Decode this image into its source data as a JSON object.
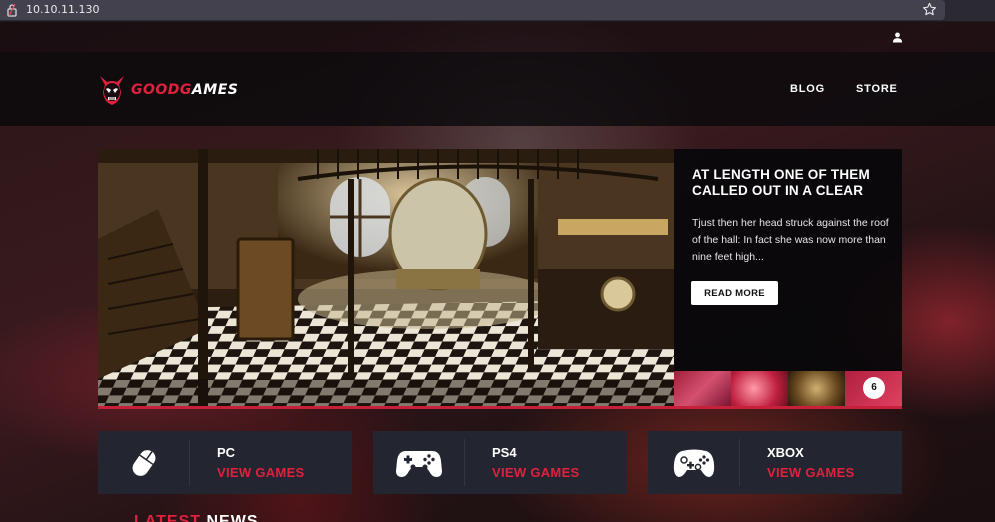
{
  "browser": {
    "url": "10.10.11.130"
  },
  "header": {
    "logo_part1": "GOOD",
    "logo_part2": "G",
    "logo_part3": "AMES",
    "nav": [
      {
        "label": "BLOG"
      },
      {
        "label": "STORE"
      }
    ]
  },
  "slider": {
    "title": "AT LENGTH ONE OF THEM CALLED OUT IN A CLEAR",
    "text": "Tjust then her head struck against the roof of the hall: In fact she was now more than nine feet high...",
    "button": "READ MORE",
    "thumb_count": "6"
  },
  "platforms": [
    {
      "name": "PC",
      "link": "VIEW GAMES",
      "icon": "mouse-icon"
    },
    {
      "name": "PS4",
      "link": "VIEW GAMES",
      "icon": "gamepad-icon"
    },
    {
      "name": "XBOX",
      "link": "VIEW GAMES",
      "icon": "xbox-controller-icon"
    }
  ],
  "section": {
    "heading_part1": "LATEST",
    "heading_part2": "NEWS"
  },
  "colors": {
    "accent": "#e0213e",
    "card_bg": "#232530",
    "header_bg": "#0a0a0c"
  }
}
